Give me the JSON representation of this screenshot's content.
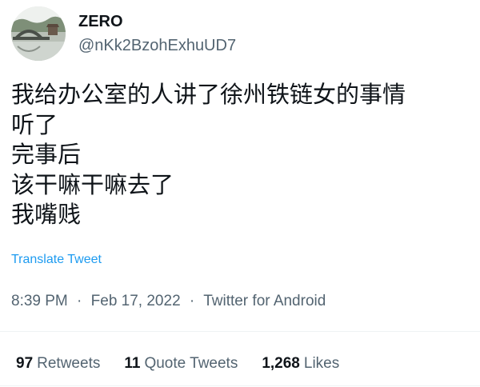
{
  "author": {
    "display_name": "ZERO",
    "handle": "@nKk2BzohExhuUD7",
    "avatar_icon": "bridge-landscape-avatar"
  },
  "tweet": {
    "lines": [
      "我给办公室的人讲了徐州铁链女的事情",
      "听了",
      "完事后",
      "该干嘛干嘛去了",
      "我嘴贱"
    ],
    "translate_label": "Translate Tweet"
  },
  "meta": {
    "time": "8:39 PM",
    "separator": "·",
    "date": "Feb 17, 2022",
    "source": "Twitter for Android"
  },
  "stats": {
    "retweets_count": "97",
    "retweets_label": "Retweets",
    "quotes_count": "11",
    "quotes_label": "Quote Tweets",
    "likes_count": "1,268",
    "likes_label": "Likes"
  },
  "colors": {
    "text": "#0f1419",
    "secondary": "#536471",
    "link": "#1d9bf0",
    "divider": "#eff3f4"
  }
}
